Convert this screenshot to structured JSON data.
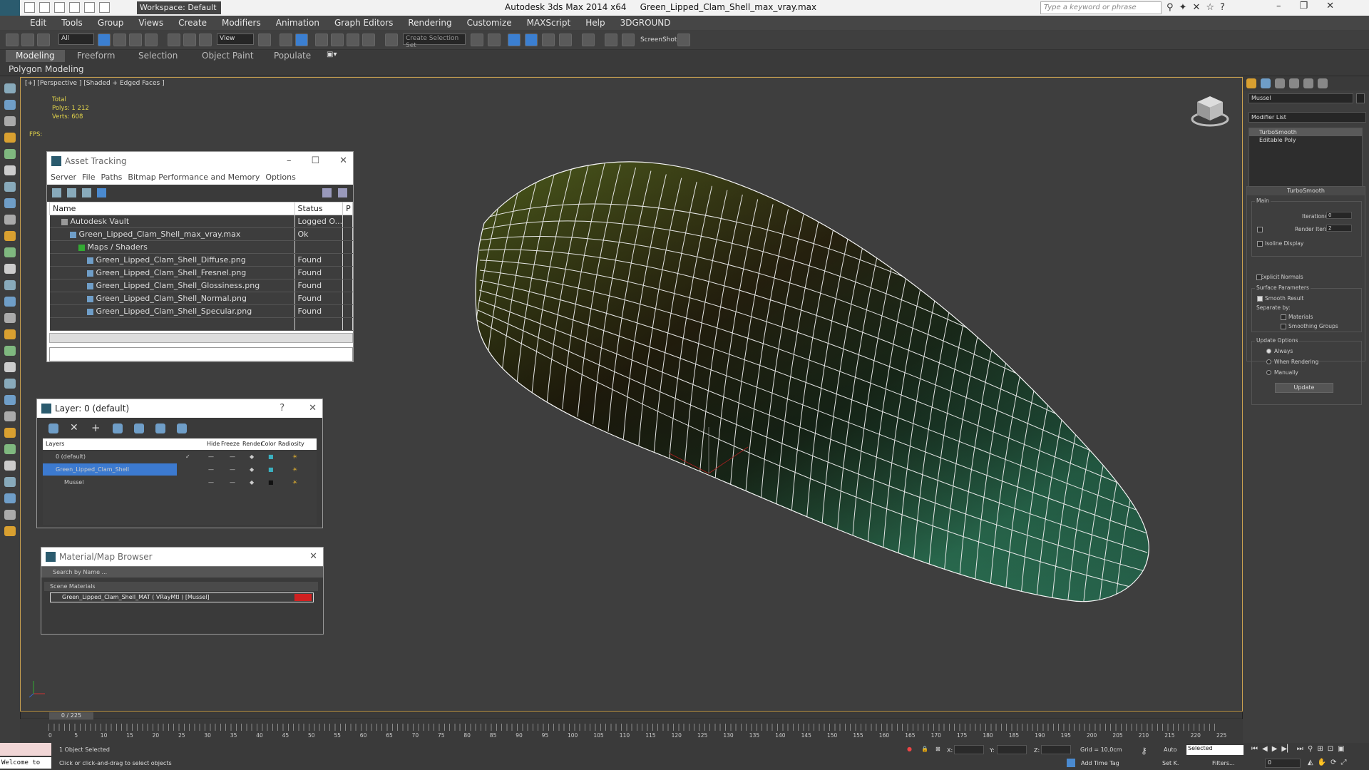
{
  "titlebar": {
    "workspace": "Workspace: Default",
    "title_app": "Autodesk 3ds Max  2014 x64",
    "title_file": "Green_Lipped_Clam_Shell_max_vray.max",
    "search_placeholder": "Type a keyword or phrase",
    "minimize": "–",
    "maximize": "❐",
    "close": "✕",
    "help": "?"
  },
  "menu": [
    "Edit",
    "Tools",
    "Group",
    "Views",
    "Create",
    "Modifiers",
    "Animation",
    "Graph Editors",
    "Rendering",
    "Customize",
    "MAXScript",
    "Help",
    "3DGROUND"
  ],
  "toolbar": {
    "filter": "All",
    "refcoord": "View",
    "named_sel": "Create Selection Set",
    "screenshot": "ScreenShot"
  },
  "ribbon": {
    "tabs": [
      "Modeling",
      "Freeform",
      "Selection",
      "Object Paint",
      "Populate"
    ],
    "active_tab": "Modeling",
    "panel": "Polygon Modeling"
  },
  "viewport": {
    "label": "[+] [Perspective ] [Shaded + Edged Faces ]",
    "stats_total": "Total",
    "polys_label": "Polys:",
    "polys_value": "1 212",
    "verts_label": "Verts:",
    "verts_value": "608",
    "fps_label": "FPS:"
  },
  "asset_tracking": {
    "title": "Asset Tracking",
    "menu": [
      "Server",
      "File",
      "Paths",
      "Bitmap Performance and Memory",
      "Options"
    ],
    "col_name": "Name",
    "col_status": "Status",
    "col_p": "P",
    "rows": [
      {
        "name": "Autodesk Vault",
        "status": "Logged O...",
        "indent": 1
      },
      {
        "name": "Green_Lipped_Clam_Shell_max_vray.max",
        "status": "Ok",
        "indent": 2
      },
      {
        "name": "Maps / Shaders",
        "status": "",
        "indent": 3
      },
      {
        "name": "Green_Lipped_Clam_Shell_Diffuse.png",
        "status": "Found",
        "indent": 4
      },
      {
        "name": "Green_Lipped_Clam_Shell_Fresnel.png",
        "status": "Found",
        "indent": 4
      },
      {
        "name": "Green_Lipped_Clam_Shell_Glossiness.png",
        "status": "Found",
        "indent": 4
      },
      {
        "name": "Green_Lipped_Clam_Shell_Normal.png",
        "status": "Found",
        "indent": 4
      },
      {
        "name": "Green_Lipped_Clam_Shell_Specular.png",
        "status": "Found",
        "indent": 4
      }
    ]
  },
  "layer_window": {
    "title": "Layer: 0 (default)",
    "help": "?",
    "close": "✕",
    "cols": [
      "Layers",
      "Hide",
      "Freeze",
      "Render",
      "Color",
      "Radiosity"
    ],
    "rows": [
      {
        "name": "0 (default)",
        "indent": 0
      },
      {
        "name": "Green_Lipped_Clam_Shell",
        "indent": 0,
        "selected": true
      },
      {
        "name": "Mussel",
        "indent": 1
      }
    ]
  },
  "material_browser": {
    "title": "Material/Map Browser",
    "search": "Search by Name ...",
    "section": "Scene Materials",
    "item": "Green_Lipped_Clam_Shell_MAT ( VRayMtl ) [Mussel]"
  },
  "command_panel": {
    "object_name": "Mussel",
    "modifier_list": "Modifier List",
    "stack": [
      "TurboSmooth",
      "Editable Poly"
    ],
    "rollout": "TurboSmooth",
    "main": "Main",
    "iterations_label": "Iterations:",
    "iterations": "0",
    "render_iters_label": "Render Iters:",
    "render_iters": "2",
    "isoline": "Isoline Display",
    "explicit": "Explicit Normals",
    "surface": "Surface Parameters",
    "smooth_result": "Smooth Result",
    "separate_by": "Separate by:",
    "materials": "Materials",
    "smoothing_groups": "Smoothing Groups",
    "update_options": "Update Options",
    "always": "Always",
    "when_rendering": "When Rendering",
    "manually": "Manually",
    "update_btn": "Update"
  },
  "timeline": {
    "frame": "0 / 225",
    "ticks": [
      "0",
      "5",
      "10",
      "15",
      "20",
      "25",
      "30",
      "35",
      "40",
      "45",
      "50",
      "55",
      "60",
      "65",
      "70",
      "75",
      "80",
      "85",
      "90",
      "95",
      "100",
      "105",
      "110",
      "115",
      "120",
      "125",
      "130",
      "135",
      "140",
      "145",
      "150",
      "155",
      "160",
      "165",
      "170",
      "175",
      "180",
      "185",
      "190",
      "195",
      "200",
      "205",
      "210",
      "215",
      "220",
      "225"
    ]
  },
  "status": {
    "welcome": "Welcome to",
    "selected": "1 Object Selected",
    "hint": "Click or click-and-drag to select objects",
    "x": "X:",
    "y": "Y:",
    "z": "Z:",
    "grid": "Grid = 10,0cm",
    "add_time_tag": "Add Time Tag",
    "auto": "Auto",
    "setk": "Set K.",
    "selected_set": "Selected",
    "filters": "Filters...",
    "frame_field": "0"
  },
  "colors": {
    "shell_green": "#2f7a5a",
    "shell_dark": "#1d1a0e",
    "selection_blue": "#3c7ad0",
    "viewport_border": "#c8a050",
    "stats_yellow": "#e0d24a"
  }
}
